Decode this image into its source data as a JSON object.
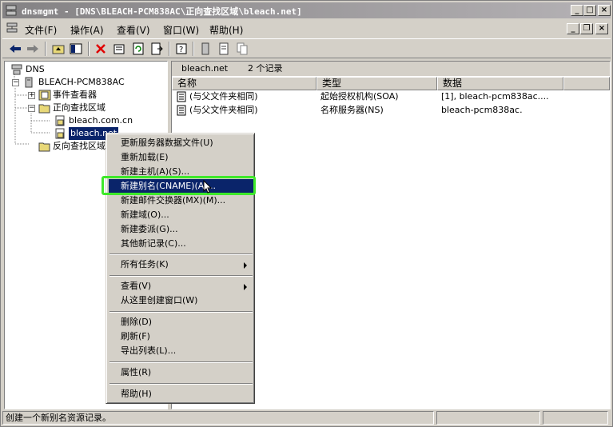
{
  "window": {
    "title": "dnsmgmt - [DNS\\BLEACH-PCM838AC\\正向查找区域\\bleach.net]",
    "buttons": {
      "minimize": "_",
      "maximize": "□",
      "close": "×"
    }
  },
  "menubar": {
    "items": [
      "文件(F)",
      "操作(A)",
      "查看(V)",
      "窗口(W)",
      "帮助(H)"
    ],
    "mdi_buttons": {
      "minimize": "_",
      "restore": "❐",
      "close": "×"
    }
  },
  "tree": {
    "root": "DNS",
    "server": "BLEACH-PCM838AC",
    "event_viewer": "事件查看器",
    "forward_zones": "正向查找区域",
    "zone_1": "bleach.com.cn",
    "zone_2": "bleach.net",
    "reverse_zones": "反向查找区域"
  },
  "list": {
    "header_zone": "bleach.net",
    "header_count": "2 个记录",
    "columns": [
      "名称",
      "类型",
      "数据"
    ],
    "rows": [
      {
        "name": "(与父文件夹相同)",
        "type": "起始授权机构(SOA)",
        "data": "[1], bleach-pcm838ac...."
      },
      {
        "name": "(与父文件夹相同)",
        "type": "名称服务器(NS)",
        "data": "bleach-pcm838ac."
      }
    ]
  },
  "context_menu": {
    "items": [
      "更新服务器数据文件(U)",
      "重新加载(E)",
      "新建主机(A)(S)...",
      "新建别名(CNAME)(A)...",
      "新建邮件交换器(MX)(M)...",
      "新建域(O)...",
      "新建委派(G)...",
      "其他新记录(C)...",
      "所有任务(K)",
      "查看(V)",
      "从这里创建窗口(W)",
      "删除(D)",
      "刷新(F)",
      "导出列表(L)...",
      "属性(R)",
      "帮助(H)"
    ]
  },
  "status": {
    "text": "创建一个新别名资源记录。"
  },
  "colors": {
    "selection": "#0a246a",
    "highlight_frame": "#3ee82a",
    "face": "#d4d0c8"
  }
}
